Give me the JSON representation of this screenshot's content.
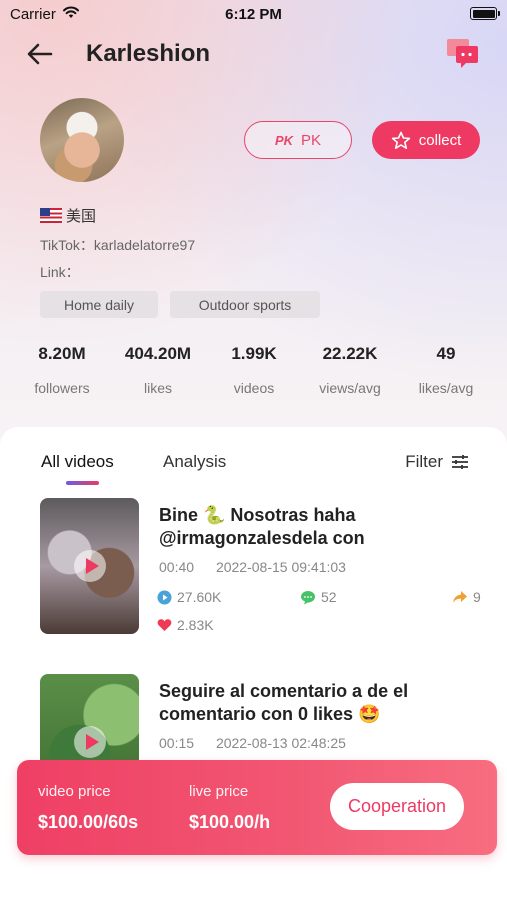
{
  "status_bar": {
    "carrier": "Carrier",
    "time": "6:12 PM"
  },
  "header": {
    "title": "Karleshion"
  },
  "profile": {
    "pk_label": "PK",
    "collect_label": "collect",
    "country": "美国",
    "tiktok": "TikTok：karladelatorre97",
    "link": "Link："
  },
  "tags": [
    "Home daily",
    "Outdoor sports"
  ],
  "stats": [
    {
      "value": "8.20M",
      "label": "followers"
    },
    {
      "value": "404.20M",
      "label": "likes"
    },
    {
      "value": "1.99K",
      "label": "videos"
    },
    {
      "value": "22.22K",
      "label": "views/avg"
    },
    {
      "value": "49",
      "label": "likes/avg"
    }
  ],
  "tabs": {
    "all_videos": "All videos",
    "analysis": "Analysis",
    "filter": "Filter"
  },
  "videos": [
    {
      "title": "Bine 🐍 Nosotras haha @irmagonzalesdela con",
      "duration": "00:40",
      "date": "2022-08-15 09:41:03",
      "views": "27.60K",
      "comments": "52",
      "shares": "9",
      "likes": "2.83K"
    },
    {
      "title": "Seguire al comentario a de el comentario con 0 likes 🤩",
      "duration": "00:15",
      "date": "2022-08-13 02:48:25"
    }
  ],
  "pricing": {
    "video_label": "video price",
    "video_value": "$100.00/60s",
    "live_label": "live price",
    "live_value": "$100.00/h",
    "cta": "Cooperation"
  },
  "colors": {
    "accent": "#ee3a62"
  }
}
